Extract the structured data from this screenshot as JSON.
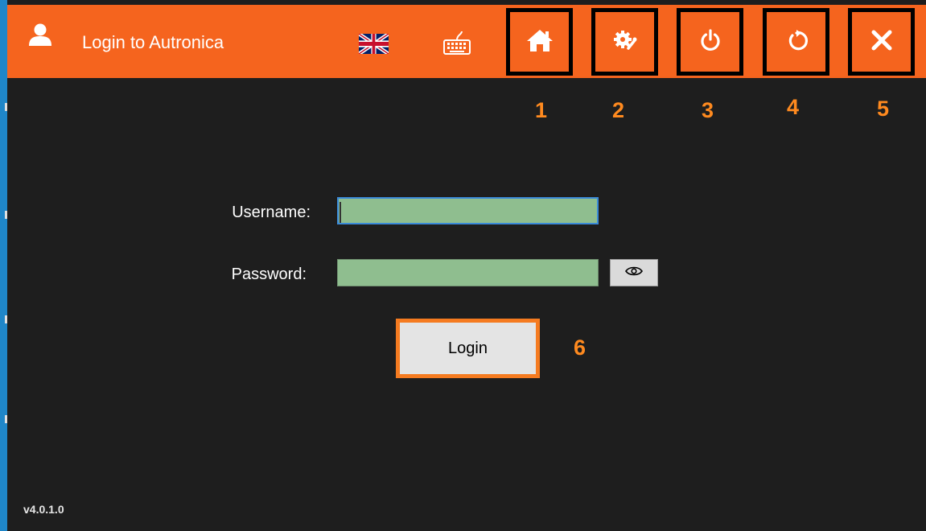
{
  "header": {
    "title": "Login to Autronica",
    "user_icon": "user-icon",
    "language_icon": "uk-flag-icon",
    "keyboard_icon": "keyboard-icon",
    "buttons": [
      {
        "id": "home",
        "icon": "home-icon",
        "callout": "1"
      },
      {
        "id": "settings",
        "icon": "gear-wrench-icon",
        "callout": "2"
      },
      {
        "id": "power",
        "icon": "power-icon",
        "callout": "3"
      },
      {
        "id": "restart",
        "icon": "restart-icon",
        "callout": "4"
      },
      {
        "id": "close",
        "icon": "close-icon",
        "callout": "5"
      }
    ]
  },
  "form": {
    "username_label": "Username:",
    "username_value": "",
    "password_label": "Password:",
    "password_value": "",
    "show_password_icon": "eye-icon",
    "login_label": "Login",
    "login_callout": "6"
  },
  "footer": {
    "version": "v4.0.1.0"
  },
  "colors": {
    "header_bg": "#f5641e",
    "body_bg": "#1e1e1e",
    "field_bg": "#8fbe8f",
    "callout": "#ff8a1f",
    "highlight_border": "#000000",
    "login_border": "#f57b20"
  }
}
